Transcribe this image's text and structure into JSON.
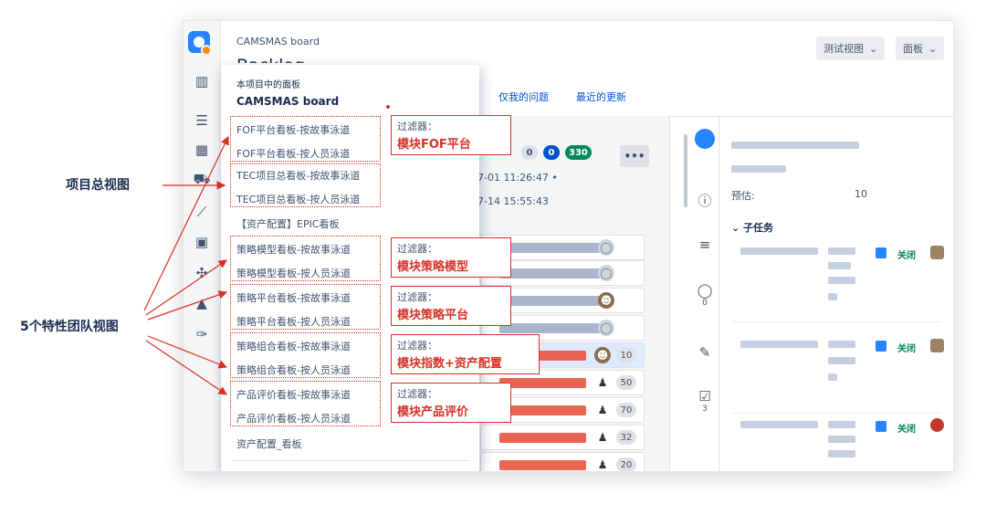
{
  "annotations": {
    "project_overview": "项目总视图",
    "team_views": "5个特性团队视图"
  },
  "header": {
    "project_name": "CAMSMAS board",
    "page_title": "Backlog",
    "view_button": "测试视图",
    "board_button": "面板"
  },
  "quick_filters": [
    "仅我的问题",
    "最近的更新"
  ],
  "sprint": {
    "badges": [
      "0",
      "0",
      "330"
    ],
    "start_fragment": "7-01 11:26:47 •",
    "end_fragment": "7-14 15:55:43",
    "more_label": "•••"
  },
  "cards": [
    {
      "points": "10"
    },
    {
      "points": "50"
    },
    {
      "points": "70"
    },
    {
      "points": "32"
    },
    {
      "points": "20"
    }
  ],
  "side_strip": {
    "comments_count": "0",
    "checklist_count": "3"
  },
  "detail": {
    "estimate_label": "预估:",
    "estimate_value": "10",
    "subtasks_heading": "子任务",
    "status_closed": "关闭"
  },
  "dropdown": {
    "section_label": "本项目中的面板",
    "current_board": "CAMSMAS board",
    "items": [
      "FOF平台看板-按故事泳道",
      "FOF平台看板-按人员泳道",
      "TEC项目总看板-按故事泳道",
      "TEC项目总看板-按人员泳道",
      "【资产配置】EPIC看板",
      "策略模型看板-按故事泳道",
      "策略模型看板-按人员泳道",
      "策略平台看板-按故事泳道",
      "策略平台看板-按人员泳道",
      "策略组合看板-按故事泳道",
      "策略组合看板-按人员泳道",
      "产品评价看板-按故事泳道",
      "产品评价看板-按人员泳道",
      "资产配置_看板"
    ]
  },
  "filters": {
    "label": "过滤器：",
    "values": [
      "模块FOF平台",
      "模块策略模型",
      "模块策略平台",
      "模块指数+资产配置",
      "模块产品评价"
    ]
  },
  "colors": {
    "annotation_red": "#d93025",
    "link_blue": "#0052cc",
    "text_dark": "#172b4d"
  }
}
